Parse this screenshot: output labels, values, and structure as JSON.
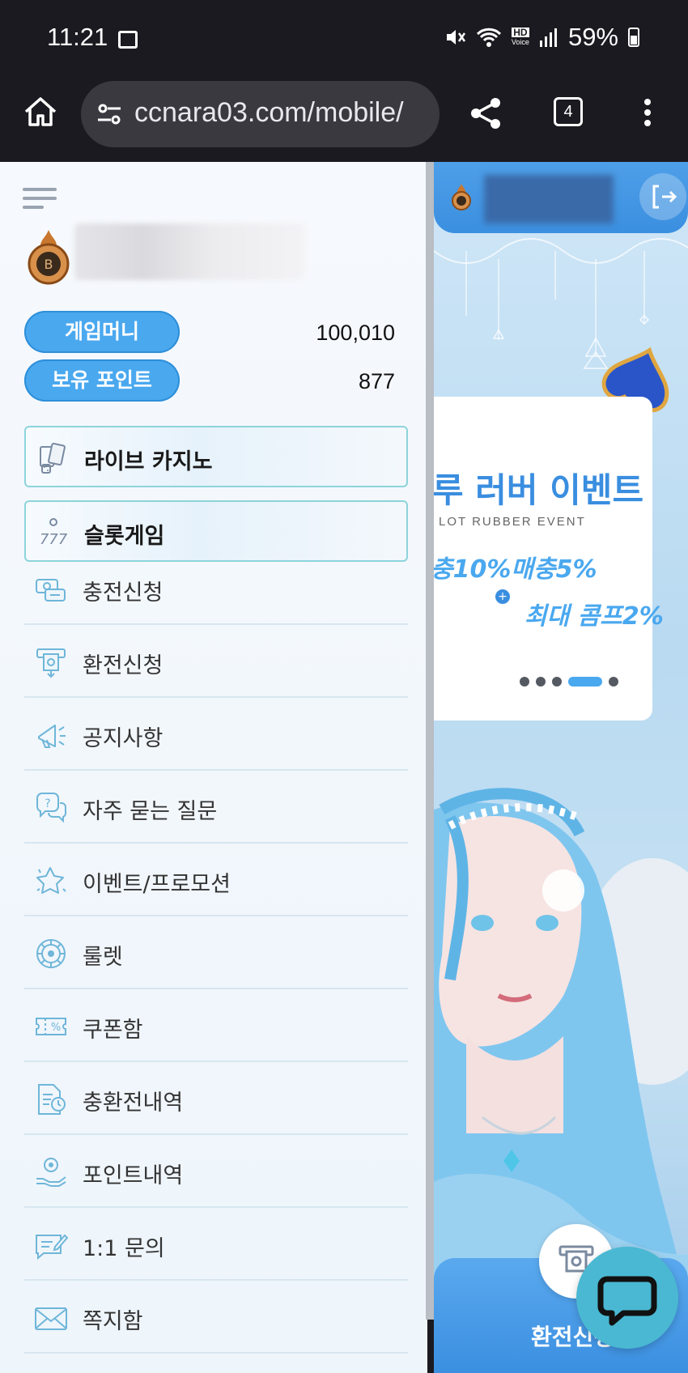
{
  "status_bar": {
    "time": "11:21",
    "hd_top": "HD",
    "hd_bottom": "Voice",
    "battery": "59%"
  },
  "browser": {
    "url": "ccnara03.com/mobile/",
    "tab_count": "4"
  },
  "drawer": {
    "balances": [
      {
        "label": "게임머니",
        "value": "100,010"
      },
      {
        "label": "보유 포인트",
        "value": "877"
      }
    ],
    "featured": [
      {
        "label": "라이브 카지노",
        "icon": "cards-icon"
      },
      {
        "label": "슬롯게임",
        "icon": "slot-777-icon"
      }
    ],
    "menu": [
      {
        "label": "충전신청",
        "icon": "deposit-icon"
      },
      {
        "label": "환전신청",
        "icon": "atm-withdraw-icon"
      },
      {
        "label": "공지사항",
        "icon": "megaphone-icon"
      },
      {
        "label": "자주 묻는 질문",
        "icon": "faq-icon"
      },
      {
        "label": "이벤트/프로모션",
        "icon": "stars-icon"
      },
      {
        "label": "룰렛",
        "icon": "roulette-icon"
      },
      {
        "label": "쿠폰함",
        "icon": "coupon-icon"
      },
      {
        "label": "충환전내역",
        "icon": "history-icon"
      },
      {
        "label": "포인트내역",
        "icon": "point-hand-icon"
      },
      {
        "label": "1:1 문의",
        "icon": "inquiry-icon"
      },
      {
        "label": "쪽지함",
        "icon": "envelope-icon"
      }
    ]
  },
  "content": {
    "event": {
      "title": "루 러버 이벤트",
      "subtitle": "LOT RUBBER EVENT",
      "line1": "충10%매충5%",
      "line2": "최대 콤프2%"
    },
    "carousel": {
      "count": 5,
      "active_index": 3
    },
    "exchange_label": "환전신청"
  },
  "colors": {
    "accent": "#4aa8ef",
    "browser_bg": "#1b1a20",
    "chat": "#4ab8d2"
  }
}
